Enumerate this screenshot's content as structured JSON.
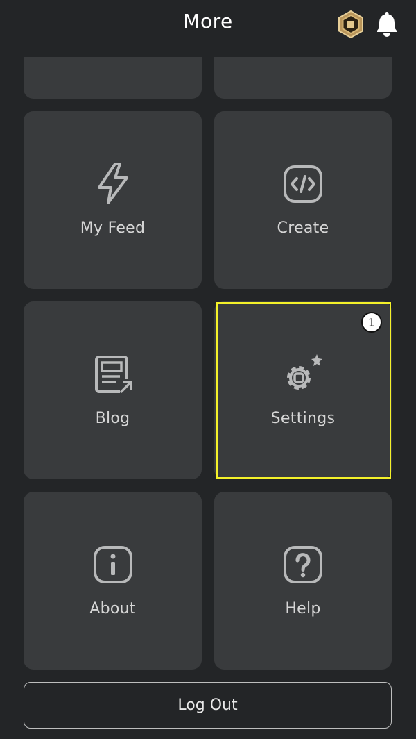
{
  "header": {
    "title": "More",
    "robux_icon": "robux-hexagon-icon",
    "notification_icon": "bell-icon"
  },
  "tiles": [
    {
      "label": "My Feed",
      "icon": "lightning-icon"
    },
    {
      "label": "Create",
      "icon": "code-brackets-icon"
    },
    {
      "label": "Blog",
      "icon": "blog-article-icon"
    },
    {
      "label": "Settings",
      "icon": "gear-icon"
    },
    {
      "label": "About",
      "icon": "info-icon"
    },
    {
      "label": "Help",
      "icon": "question-icon"
    }
  ],
  "annotation": {
    "step": "1"
  },
  "logout": {
    "label": "Log Out"
  },
  "colors": {
    "background": "#232527",
    "tile": "#393b3d",
    "highlight": "#f4f12a",
    "robux_gold": "#c9a66b"
  }
}
